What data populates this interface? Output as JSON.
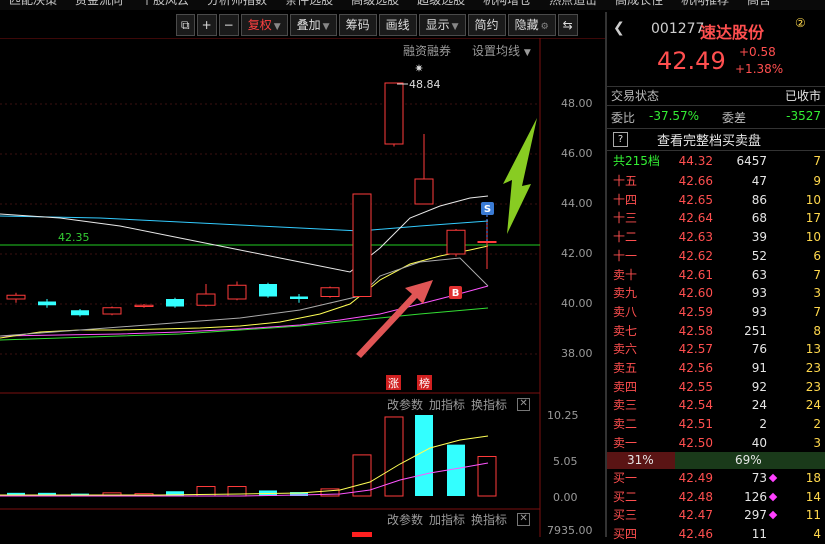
{
  "top_menu": [
    "匹配决策",
    "资金流向",
    "个股风云",
    "分析师指数",
    "条件选股",
    "高级选股",
    "超级选股",
    "机构增仓",
    "热点追击",
    "高成长性",
    "机构推荐",
    "高含"
  ],
  "toolbar": {
    "restore_label": "复权",
    "overlay_label": "叠加",
    "chips_label": "筹码",
    "drawline_label": "画线",
    "display_label": "显示",
    "simple_label": "简约",
    "hide_label": "隐藏"
  },
  "chart": {
    "margin_link": "融资融券",
    "ma_setting_link": "设置均线",
    "high_label": "48.84",
    "ref_line_label": "42.35",
    "price_ticks": [
      "48.00",
      "46.00",
      "44.00",
      "42.00",
      "40.00",
      "38.00"
    ],
    "sell_marker": "S",
    "buy_marker": "B",
    "tag_limit_up": "涨",
    "tag_list": "榜",
    "ind1_links": [
      "改参数",
      "加指标",
      "换指标"
    ],
    "ind1_ticks": [
      "10.25",
      "5.05",
      "0.00"
    ],
    "ind2_links": [
      "改参数",
      "加指标",
      "换指标"
    ],
    "ind2_tick": "7935.00",
    "colors": {
      "up": "#ff3b3b",
      "down": "#33ffff",
      "ma5": "#e8e8e8",
      "ma10": "#ffff55",
      "ma20": "#ff55ff",
      "ma60": "#33dd33",
      "cyan_line": "#33ccff"
    }
  },
  "panel": {
    "code": "001277",
    "name": "速达股份",
    "badge": "②",
    "price": "42.49",
    "change": "+0.58",
    "change_pct": "+1.38%",
    "status_label": "交易状态",
    "status_value": "已收市",
    "weibi_label": "委比",
    "weibi_value": "-37.57%",
    "weicha_label": "委差",
    "weicha_value": "-3527",
    "full_depth_btn": "查看完整档买卖盘",
    "help_icon": "?",
    "total_label": "共215档",
    "total_price": "44.32",
    "total_vol": "6457",
    "total_cnt": "7",
    "sell_levels": [
      {
        "label": "十五",
        "price": "42.66",
        "vol": "47",
        "cnt": "9"
      },
      {
        "label": "十四",
        "price": "42.65",
        "vol": "86",
        "cnt": "10"
      },
      {
        "label": "十三",
        "price": "42.64",
        "vol": "68",
        "cnt": "17"
      },
      {
        "label": "十二",
        "price": "42.63",
        "vol": "39",
        "cnt": "10"
      },
      {
        "label": "十一",
        "price": "42.62",
        "vol": "52",
        "cnt": "6"
      },
      {
        "label": "卖十",
        "price": "42.61",
        "vol": "63",
        "cnt": "7"
      },
      {
        "label": "卖九",
        "price": "42.60",
        "vol": "93",
        "cnt": "3"
      },
      {
        "label": "卖八",
        "price": "42.59",
        "vol": "93",
        "cnt": "7"
      },
      {
        "label": "卖七",
        "price": "42.58",
        "vol": "251",
        "cnt": "8"
      },
      {
        "label": "卖六",
        "price": "42.57",
        "vol": "76",
        "cnt": "13"
      },
      {
        "label": "卖五",
        "price": "42.56",
        "vol": "91",
        "cnt": "23"
      },
      {
        "label": "卖四",
        "price": "42.55",
        "vol": "92",
        "cnt": "23"
      },
      {
        "label": "卖三",
        "price": "42.54",
        "vol": "24",
        "cnt": "24"
      },
      {
        "label": "卖二",
        "price": "42.51",
        "vol": "2",
        "cnt": "2"
      },
      {
        "label": "卖一",
        "price": "42.50",
        "vol": "40",
        "cnt": "3"
      }
    ],
    "ratio_sell": "31%",
    "ratio_buy": "69%",
    "ratio_buy_fraction": 0.69,
    "buy_levels": [
      {
        "label": "买一",
        "price": "42.49",
        "vol": "73",
        "cnt": "18"
      },
      {
        "label": "买二",
        "price": "42.48",
        "vol": "126",
        "cnt": "14"
      },
      {
        "label": "买三",
        "price": "42.47",
        "vol": "297",
        "cnt": "11"
      },
      {
        "label": "买四",
        "price": "42.46",
        "vol": "11",
        "cnt": "4"
      }
    ]
  }
}
